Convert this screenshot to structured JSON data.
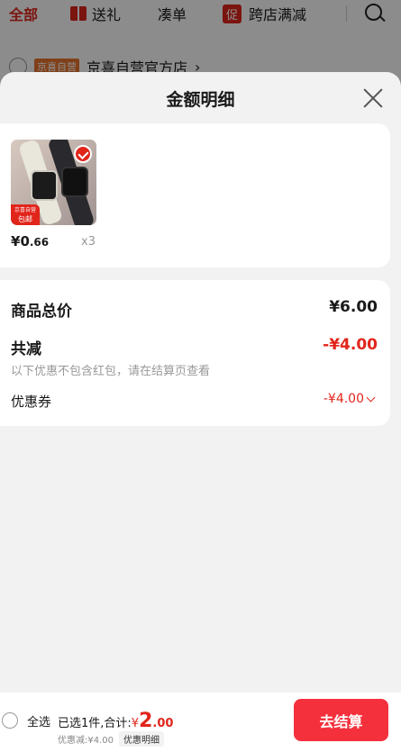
{
  "background": {
    "tabs": {
      "all": "全部",
      "gift": "送礼",
      "bundle": "凑单",
      "promo_badge": "促",
      "promo": "跨店满减"
    },
    "store": {
      "badge": "京喜自营",
      "name": "京喜自营官方店",
      "arrow": "›"
    }
  },
  "panel": {
    "title": "金额明细",
    "product": {
      "ship_tag_small": "京喜自营",
      "ship_tag": "包邮",
      "price_symbol": "¥",
      "price_int": "0",
      "price_dec": ".66",
      "qty": "x3"
    },
    "summary": {
      "total_label": "商品总价",
      "total_value": "¥6.00",
      "reduce_label": "共减",
      "reduce_value": "-¥4.00",
      "note": "以下优惠不包含红包，请在结算页查看",
      "coupon_label": "优惠券",
      "coupon_value": "-¥4.00"
    }
  },
  "bottom_bar": {
    "select_all": "全选",
    "selected_text": "已选1件,合计:",
    "total_symbol": "¥",
    "total_int": "2",
    "total_dec": ".00",
    "discount": "优惠减:¥4.00",
    "detail_link": "优惠明细",
    "checkout": "去结算"
  },
  "colors": {
    "accent": "#e1251b",
    "checkout": "#f5303d"
  }
}
